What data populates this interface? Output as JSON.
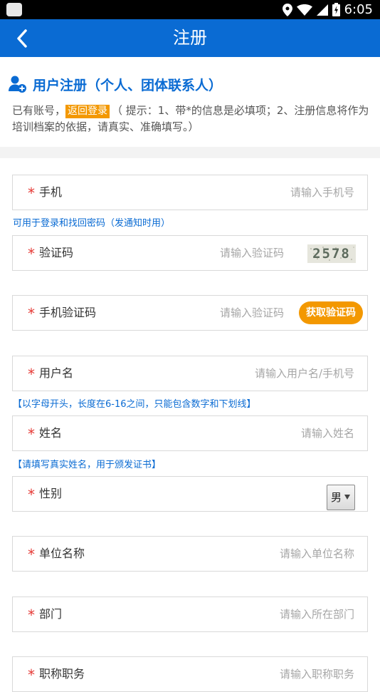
{
  "status_bar": {
    "time": "6:05"
  },
  "app_bar": {
    "title": "注册"
  },
  "section": {
    "title": "用户注册（个人、团体联系人）"
  },
  "intro": {
    "prefix": "已有账号，",
    "login_link": "返回登录",
    "hint": "（ 提示：1、带*的信息是必填项；2、注册信息将作为培训档案的依据，请真实、准确填写。）"
  },
  "form": {
    "phone": {
      "star": "*",
      "label": "手机",
      "placeholder": "请输入手机号",
      "note": "可用于登录和找回密码（发通知时用）"
    },
    "captcha": {
      "star": "*",
      "label": "验证码",
      "placeholder": "请输入验证码",
      "image_text": "2578"
    },
    "sms_code": {
      "star": "*",
      "label": "手机验证码",
      "placeholder": "请输入验证码",
      "button": "获取验证码"
    },
    "username": {
      "star": "*",
      "label": "用户名",
      "placeholder": "请输入用户名/手机号",
      "note": "【以字母开头，长度在6-16之间，只能包含数字和下划线】"
    },
    "name": {
      "star": "*",
      "label": "姓名",
      "placeholder": "请输入姓名",
      "note": "【请填写真实姓名，用于颁发证书】"
    },
    "gender": {
      "star": "*",
      "label": "性别",
      "selected": "男"
    },
    "company": {
      "star": "*",
      "label": "单位名称",
      "placeholder": "请输入单位名称"
    },
    "department": {
      "star": "*",
      "label": "部门",
      "placeholder": "请输入所在部门"
    },
    "position": {
      "star": "*",
      "label": "职称职务",
      "placeholder": "请输入职称职务"
    }
  },
  "colors": {
    "primary": "#0a6bd3",
    "accent": "#f39800",
    "required": "#e53935"
  }
}
